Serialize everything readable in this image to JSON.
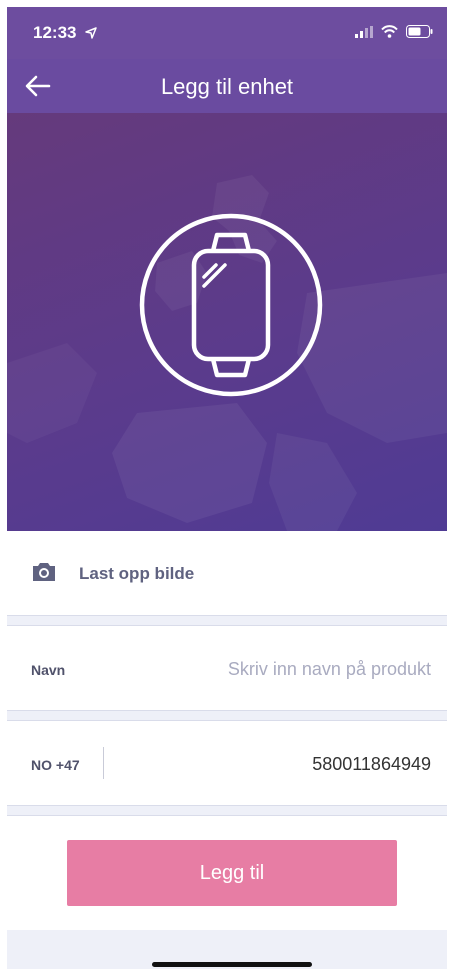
{
  "status_bar": {
    "time": "12:33"
  },
  "nav": {
    "title": "Legg til enhet"
  },
  "upload": {
    "label": "Last opp bilde"
  },
  "name_field": {
    "label": "Navn",
    "placeholder": "Skriv inn navn på produkt",
    "value": ""
  },
  "phone_field": {
    "country_code": "NO +47",
    "value": "580011864949"
  },
  "actions": {
    "add_label": "Legg til"
  },
  "colors": {
    "header": "#6a4ba0",
    "button": "#e77da4",
    "separator": "#eef0f8",
    "label": "#50526b"
  },
  "icons": {
    "back": "arrow-left-icon",
    "device": "smartwatch-icon",
    "upload": "camera-icon"
  }
}
